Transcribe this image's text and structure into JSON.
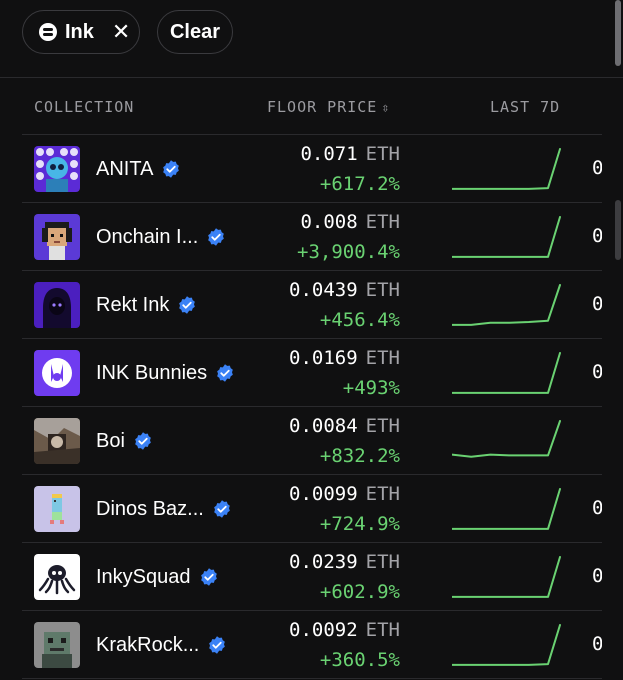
{
  "filters": {
    "chip_label": "Ink",
    "chip_close": "✕",
    "clear_label": "Clear"
  },
  "table": {
    "headers": {
      "collection": "COLLECTION",
      "floor_price": "FLOOR PRICE",
      "floor_sort": "⇳",
      "last_7d": "LAST 7D"
    },
    "rows": [
      {
        "name": "ANITA",
        "price": "0.071",
        "unit": "ETH",
        "change": "+617.2%",
        "cut": "0",
        "spark": [
          0.95,
          0.95,
          0.95,
          0.95,
          0.95,
          0.93,
          0.0
        ],
        "avatar": "anita"
      },
      {
        "name": "Onchain I...",
        "price": "0.008",
        "unit": "ETH",
        "change": "+3,900.4%",
        "cut": "0",
        "spark": [
          0.95,
          0.95,
          0.95,
          0.95,
          0.95,
          0.95,
          0.0
        ],
        "avatar": "onchain"
      },
      {
        "name": "Rekt Ink",
        "price": "0.0439",
        "unit": "ETH",
        "change": "+456.4%",
        "cut": "0",
        "spark": [
          0.95,
          0.95,
          0.9,
          0.9,
          0.88,
          0.85,
          0.0
        ],
        "avatar": "rekt"
      },
      {
        "name": "INK Bunnies",
        "price": "0.0169",
        "unit": "ETH",
        "change": "+493%",
        "cut": "0",
        "spark": [
          0.95,
          0.95,
          0.95,
          0.95,
          0.95,
          0.95,
          0.0
        ],
        "avatar": "bunnies"
      },
      {
        "name": "Boi",
        "price": "0.0084",
        "unit": "ETH",
        "change": "+832.2%",
        "cut": "",
        "spark": [
          0.8,
          0.85,
          0.8,
          0.82,
          0.82,
          0.82,
          0.0
        ],
        "avatar": "boi"
      },
      {
        "name": "Dinos Baz...",
        "price": "0.0099",
        "unit": "ETH",
        "change": "+724.9%",
        "cut": "0",
        "spark": [
          0.95,
          0.95,
          0.95,
          0.95,
          0.95,
          0.95,
          0.0
        ],
        "avatar": "dinos"
      },
      {
        "name": "InkySquad",
        "price": "0.0239",
        "unit": "ETH",
        "change": "+602.9%",
        "cut": "0",
        "spark": [
          0.95,
          0.95,
          0.95,
          0.95,
          0.95,
          0.95,
          0.0
        ],
        "avatar": "inky"
      },
      {
        "name": "KrakRock...",
        "price": "0.0092",
        "unit": "ETH",
        "change": "+360.5%",
        "cut": "0",
        "spark": [
          0.95,
          0.95,
          0.95,
          0.95,
          0.95,
          0.93,
          0.0
        ],
        "avatar": "krak"
      }
    ]
  },
  "colors": {
    "background": "#101011",
    "positive": "#6ad272",
    "verified": "#3b82f6",
    "muted": "#9b9ba0"
  }
}
